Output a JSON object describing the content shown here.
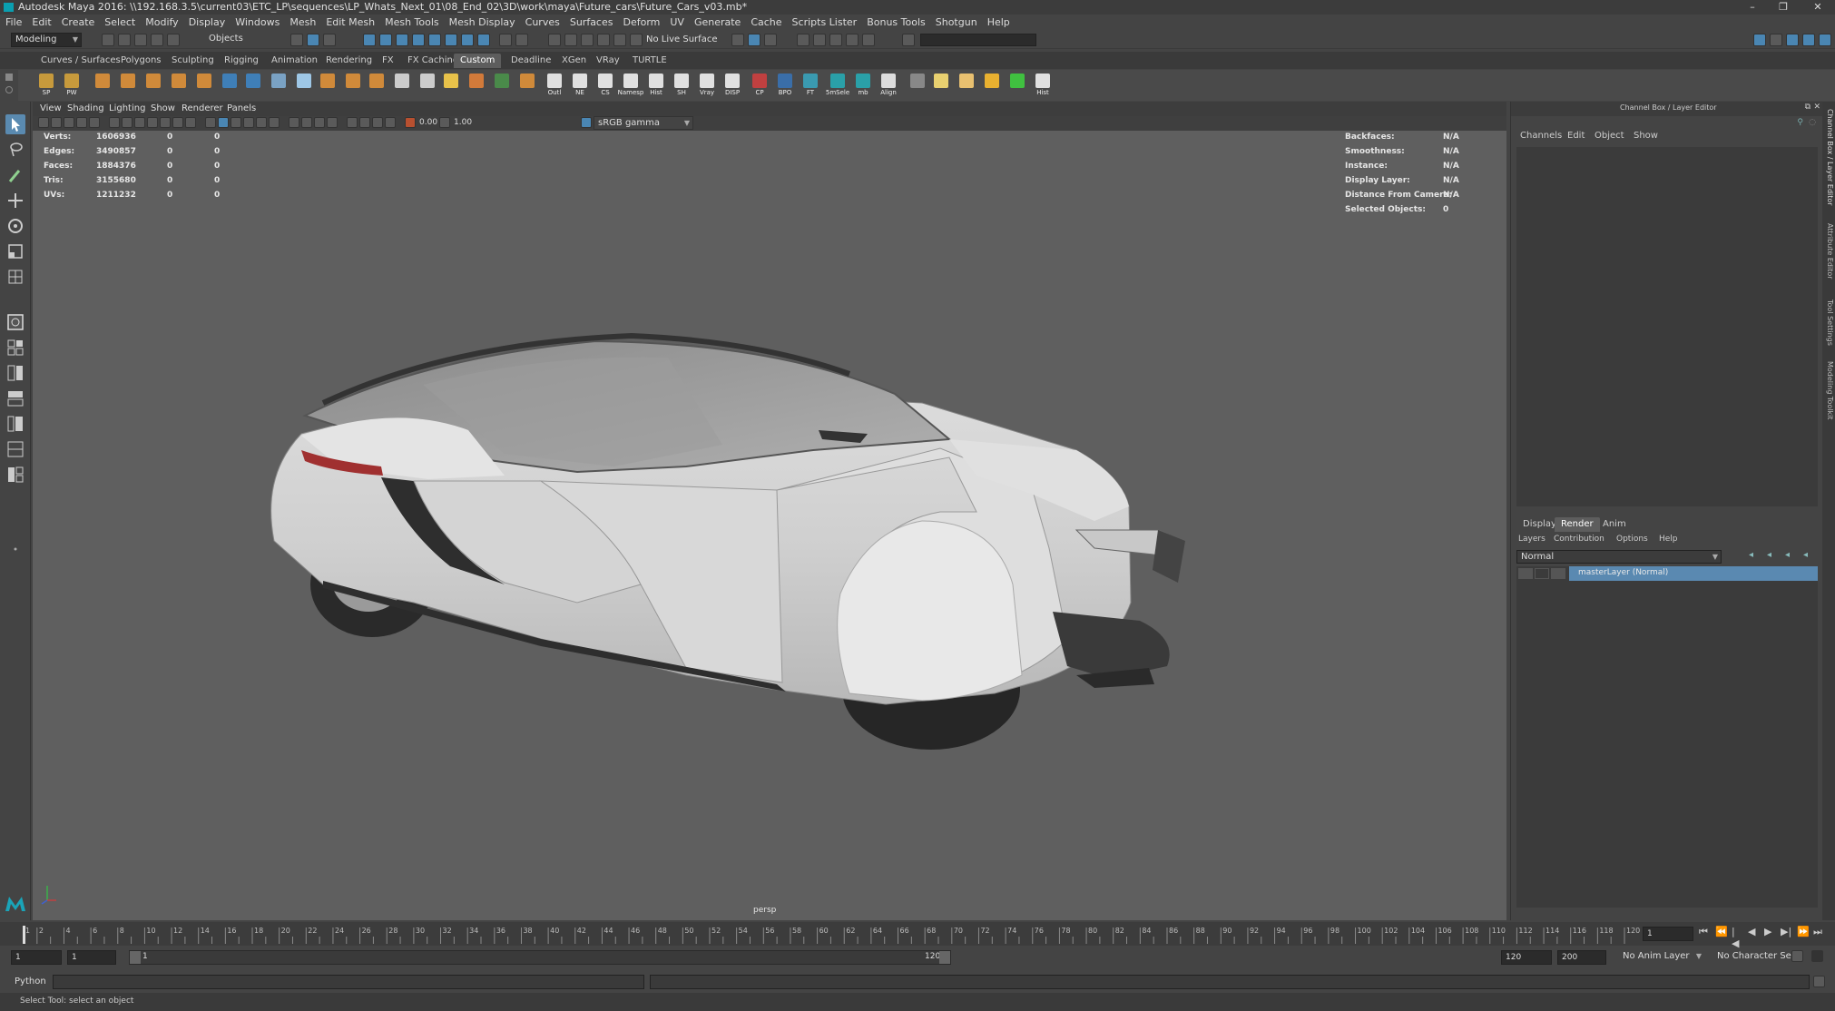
{
  "window": {
    "title": "Autodesk Maya 2016: \\\\192.168.3.5\\current03\\ETC_LP\\sequences\\LP_Whats_Next_01\\08_End_02\\3D\\work\\maya\\Future_cars\\Future_Cars_v03.mb*",
    "controls": [
      "–",
      "❐",
      "✕"
    ]
  },
  "menubar": [
    "File",
    "Edit",
    "Create",
    "Select",
    "Modify",
    "Display",
    "Windows",
    "Mesh",
    "Edit Mesh",
    "Mesh Tools",
    "Mesh Display",
    "Curves",
    "Surfaces",
    "Deform",
    "UV",
    "Generate",
    "Cache",
    "Scripts Lister",
    "Bonus Tools",
    "Shotgun",
    "Help"
  ],
  "statusline": {
    "menuset": "Modeling",
    "select_mode": "Objects",
    "live_surface": "No Live Surface"
  },
  "shelf_tabs": [
    "Curves / Surfaces",
    "Polygons",
    "Sculpting",
    "Rigging",
    "Animation",
    "Rendering",
    "FX",
    "FX Caching",
    "Custom",
    "Deadline",
    "XGen",
    "VRay",
    "TURTLE"
  ],
  "shelf_active": "Custom",
  "shelf_buttons": [
    {
      "label": "SP",
      "color": "#c79a3c"
    },
    {
      "label": "PW",
      "color": "#c79a3c"
    },
    {
      "label": "",
      "color": "#d08a3a"
    },
    {
      "label": "",
      "color": "#d08a3a"
    },
    {
      "label": "",
      "color": "#d08a3a"
    },
    {
      "label": "",
      "color": "#d08a3a"
    },
    {
      "label": "",
      "color": "#d08a3a"
    },
    {
      "label": "",
      "color": "#3f7fb8"
    },
    {
      "label": "",
      "color": "#3f7fb8"
    },
    {
      "label": "",
      "color": "#7aa2c4"
    },
    {
      "label": "",
      "color": "#9ec7e6"
    },
    {
      "label": "",
      "color": "#d08a3a"
    },
    {
      "label": "",
      "color": "#d08a3a"
    },
    {
      "label": "",
      "color": "#d08a3a"
    },
    {
      "label": "",
      "color": "#cccccc"
    },
    {
      "label": "",
      "color": "#cccccc"
    },
    {
      "label": "",
      "color": "#e8c24a"
    },
    {
      "label": "",
      "color": "#d27a3a"
    },
    {
      "label": "",
      "color": "#4a8a4a"
    },
    {
      "label": "",
      "color": "#d08a3a"
    },
    {
      "label": "Outl",
      "color": "#e0e0e0"
    },
    {
      "label": "NE",
      "color": "#e0e0e0"
    },
    {
      "label": "CS",
      "color": "#e0e0e0"
    },
    {
      "label": "Namesp",
      "color": "#e0e0e0"
    },
    {
      "label": "Hist",
      "color": "#e0e0e0"
    },
    {
      "label": "SH",
      "color": "#e0e0e0"
    },
    {
      "label": "Vray",
      "color": "#e0e0e0"
    },
    {
      "label": "DISP",
      "color": "#e0e0e0"
    },
    {
      "label": "CP",
      "color": "#c04040"
    },
    {
      "label": "BPO",
      "color": "#3a6ea8"
    },
    {
      "label": "FT",
      "color": "#3a9ab0"
    },
    {
      "label": "5mSele",
      "color": "#2aa0a8"
    },
    {
      "label": "mb",
      "color": "#2aa0a8"
    },
    {
      "label": "Align",
      "color": "#dddddd"
    },
    {
      "label": "",
      "color": "#888888"
    },
    {
      "label": "",
      "color": "#e8d070"
    },
    {
      "label": "",
      "color": "#e8c070"
    },
    {
      "label": "",
      "color": "#e8b030"
    },
    {
      "label": "",
      "color": "#40c040"
    },
    {
      "label": "Hist",
      "color": "#e0e0e0"
    }
  ],
  "panel_menu": [
    "View",
    "Shading",
    "Lighting",
    "Show",
    "Renderer",
    "Panels"
  ],
  "panel_toolbar": {
    "exposure": "0.00",
    "gamma": "1.00",
    "color_space": "sRGB gamma"
  },
  "hud_left": [
    {
      "label": "Verts:",
      "v1": "1606936",
      "v2": "0",
      "v3": "0"
    },
    {
      "label": "Edges:",
      "v1": "3490857",
      "v2": "0",
      "v3": "0"
    },
    {
      "label": "Faces:",
      "v1": "1884376",
      "v2": "0",
      "v3": "0"
    },
    {
      "label": "Tris:",
      "v1": "3155680",
      "v2": "0",
      "v3": "0"
    },
    {
      "label": "UVs:",
      "v1": "1211232",
      "v2": "0",
      "v3": "0"
    }
  ],
  "hud_right": [
    {
      "label": "Backfaces:",
      "value": "N/A"
    },
    {
      "label": "Smoothness:",
      "value": "N/A"
    },
    {
      "label": "Instance:",
      "value": "N/A"
    },
    {
      "label": "Display Layer:",
      "value": "N/A"
    },
    {
      "label": "Distance From Camera:",
      "value": "N/A"
    },
    {
      "label": "Selected Objects:",
      "value": "0"
    }
  ],
  "camera_label": "persp",
  "channel_box": {
    "title": "Channel Box / Layer Editor",
    "menu": [
      "Channels",
      "Edit",
      "Object",
      "Show"
    ]
  },
  "layer_editor": {
    "tabs": [
      "Display",
      "Render",
      "Anim"
    ],
    "active_tab": "Render",
    "menu": [
      "Layers",
      "Contribution",
      "Options",
      "Help"
    ],
    "blend_mode": "Normal",
    "layer_name": "masterLayer (Normal)"
  },
  "side_tabs": [
    "Channel Box / Layer Editor",
    "Attribute Editor",
    "Tool Settings",
    "Modeling Toolkit"
  ],
  "timeline": {
    "ticks": [
      "1",
      "2",
      "4",
      "6",
      "8",
      "10",
      "12",
      "14",
      "16",
      "18",
      "20",
      "22",
      "24",
      "26",
      "28",
      "30",
      "32",
      "34",
      "36",
      "38",
      "40",
      "42",
      "44",
      "46",
      "48",
      "50",
      "52",
      "54",
      "56",
      "58",
      "60",
      "62",
      "64",
      "66",
      "68",
      "70",
      "72",
      "74",
      "76",
      "78",
      "80",
      "82",
      "84",
      "86",
      "88",
      "90",
      "92",
      "94",
      "96",
      "98",
      "100",
      "102",
      "104",
      "106",
      "108",
      "110",
      "112",
      "114",
      "116",
      "118",
      "120"
    ],
    "current_frame": "1",
    "playback_controls": [
      "⏮",
      "⏪",
      "|◀",
      "◀",
      "▶",
      "▶|",
      "⏩",
      "⏭"
    ]
  },
  "range": {
    "start": "1",
    "playback_start": "1",
    "slider_start": "1",
    "slider_end": "120",
    "playback_end": "120",
    "end": "200",
    "anim_layer": "No Anim Layer",
    "character_set": "No Character Set"
  },
  "command_line": {
    "language": "Python"
  },
  "help_line": "Select Tool: select an object"
}
